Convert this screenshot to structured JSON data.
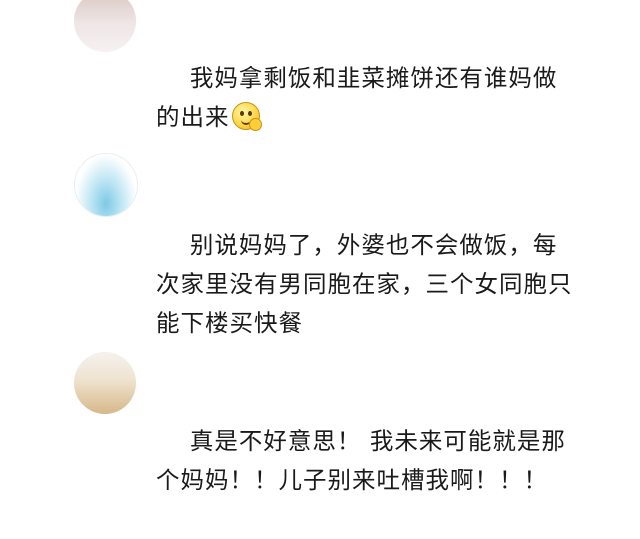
{
  "comments": [
    {
      "text": "我妈拿剩饭和韭菜摊饼还有谁妈做的出来",
      "emoji": "smile-thinking-emoji",
      "avatar_colors": [
        "#f2e9ea",
        "#d9c7c2"
      ]
    },
    {
      "text": "别说妈妈了，外婆也不会做饭，每次家里没有男同胞在家，三个女同胞只能下楼买快餐",
      "avatar_colors": [
        "#ffffff",
        "#7ec9e6"
      ]
    },
    {
      "text": "真是不好意思！ 我未来可能就是那个妈妈！！儿子别来吐槽我啊！！！",
      "avatar_colors": [
        "#f5f2ee",
        "#d6b889"
      ]
    }
  ]
}
